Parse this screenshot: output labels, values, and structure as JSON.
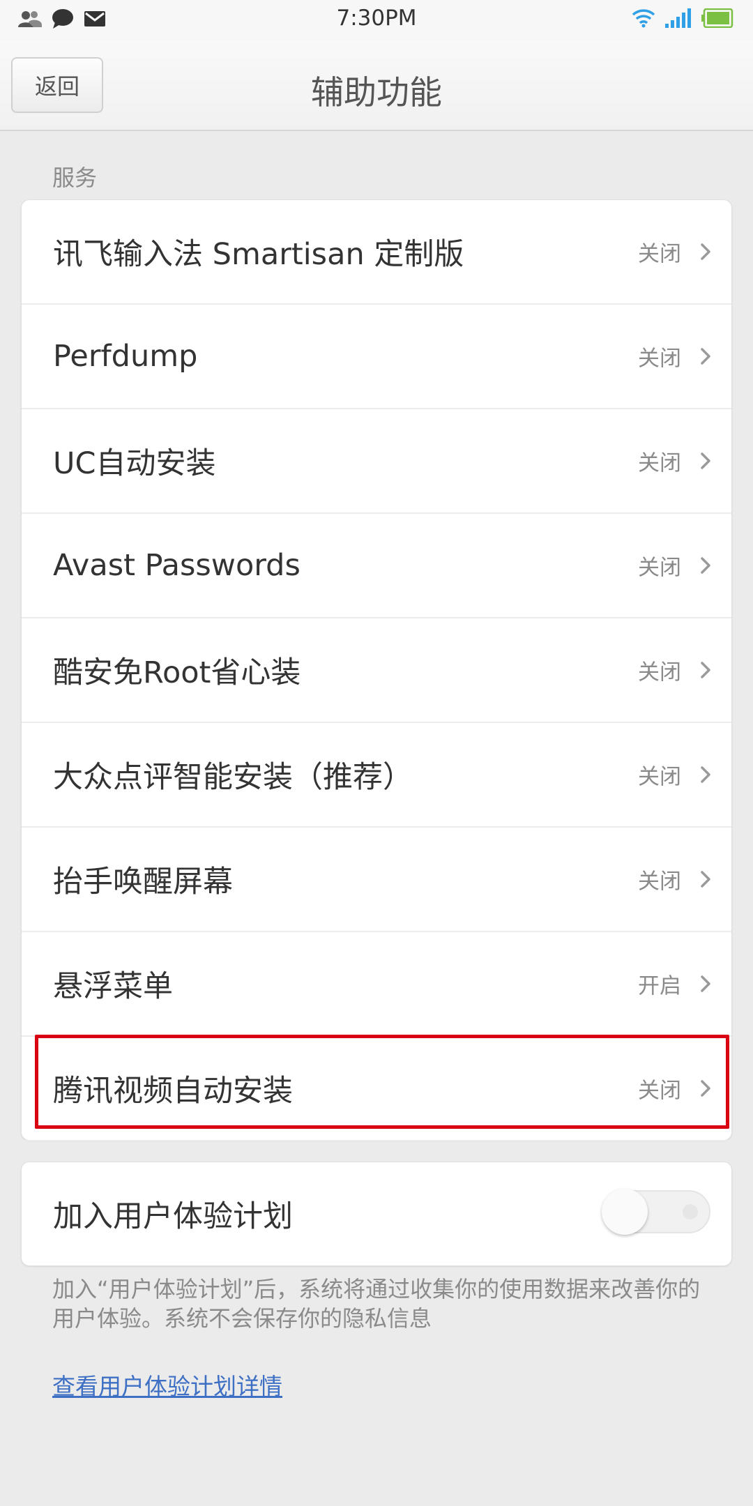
{
  "status_bar": {
    "time": "7:30PM",
    "icons": [
      "contacts-icon",
      "chat-icon",
      "mail-icon",
      "wifi-icon",
      "signal-icon",
      "battery-icon"
    ]
  },
  "nav": {
    "back_label": "返回",
    "title": "辅助功能"
  },
  "section": {
    "header": "服务"
  },
  "services": [
    {
      "label": "讯飞输入法 Smartisan 定制版",
      "status": "关闭"
    },
    {
      "label": "Perfdump",
      "status": "关闭"
    },
    {
      "label": "UC自动安装",
      "status": "关闭"
    },
    {
      "label": "Avast Passwords",
      "status": "关闭"
    },
    {
      "label": "酷安免Root省心装",
      "status": "关闭"
    },
    {
      "label": "大众点评智能安装（推荐）",
      "status": "关闭"
    },
    {
      "label": "抬手唤醒屏幕",
      "status": "关闭",
      "highlighted": true
    },
    {
      "label": "悬浮菜单",
      "status": "开启"
    },
    {
      "label": "腾讯视频自动安装",
      "status": "关闭"
    }
  ],
  "ux_plan": {
    "label": "加入用户体验计划",
    "enabled": false,
    "description": "加入“用户体验计划”后，系统将通过收集你的使用数据来改善你的用户体验。系统不会保存你的隐私信息",
    "link": "查看用户体验计划详情"
  },
  "colors": {
    "highlight": "#d90012",
    "link": "#3d6fc4",
    "battery": "#7cc043",
    "wifi": "#2f9fe6"
  }
}
